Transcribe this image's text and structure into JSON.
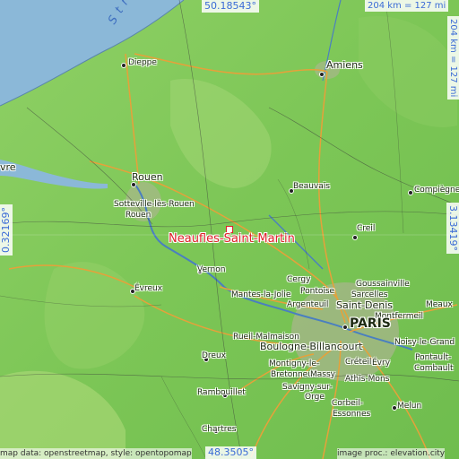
{
  "colors": {
    "sea": "#8bb8d8",
    "land": "#7fc85a",
    "land_high": "#9ed36a",
    "accent": "#e0202a",
    "coord_text": "#3a6bd6"
  },
  "coordinates": {
    "top_lat": "50.18543°",
    "bottom_lat": "48.3505°",
    "left_lon": "0.32169°",
    "right_lon": "3.13419°"
  },
  "scale": {
    "horizontal": "204 km = 127 mi",
    "vertical": "204 km = 127 mi"
  },
  "focus": {
    "name": "Neaufles-Saint-Martin"
  },
  "sea_label": "S t r a",
  "places": [
    {
      "name": "Dieppe"
    },
    {
      "name": "Amiens"
    },
    {
      "name": "Rouen"
    },
    {
      "name": "Sotteville-lès-Rouen"
    },
    {
      "name": "vre"
    },
    {
      "name": "Beauvais"
    },
    {
      "name": "Compiègne"
    },
    {
      "name": "Creil"
    },
    {
      "name": "Vernon"
    },
    {
      "name": "Évreux"
    },
    {
      "name": "Cergy"
    },
    {
      "name": "Pontoise"
    },
    {
      "name": "Goussainville"
    },
    {
      "name": "Sarcelles"
    },
    {
      "name": "Mantes-la-Jolie"
    },
    {
      "name": "Argenteuil"
    },
    {
      "name": "Saint-Denis"
    },
    {
      "name": "Meaux"
    },
    {
      "name": "Montfermeil"
    },
    {
      "name": "PARIS"
    },
    {
      "name": "Rueil-Malmaison"
    },
    {
      "name": "Noisy-le-Grand"
    },
    {
      "name": "Boulogne-Billancourt"
    },
    {
      "name": "Dreux"
    },
    {
      "name": "Créteil"
    },
    {
      "name": "Pontault-"
    },
    {
      "name": "Combault"
    },
    {
      "name": "Montigny-le-"
    },
    {
      "name": "Bretonneux"
    },
    {
      "name": "Massy"
    },
    {
      "name": "Athis-Mons"
    },
    {
      "name": "Évry"
    },
    {
      "name": "Savigny-sur-"
    },
    {
      "name": "Orge"
    },
    {
      "name": "Rambouillet"
    },
    {
      "name": "Corbeil-"
    },
    {
      "name": "Essonnes"
    },
    {
      "name": "Melun"
    },
    {
      "name": "Chartres"
    }
  ],
  "attribution_left": "map data: openstreetmap, style: opentopomap",
  "attribution_right": "image proc.: elevation.city"
}
